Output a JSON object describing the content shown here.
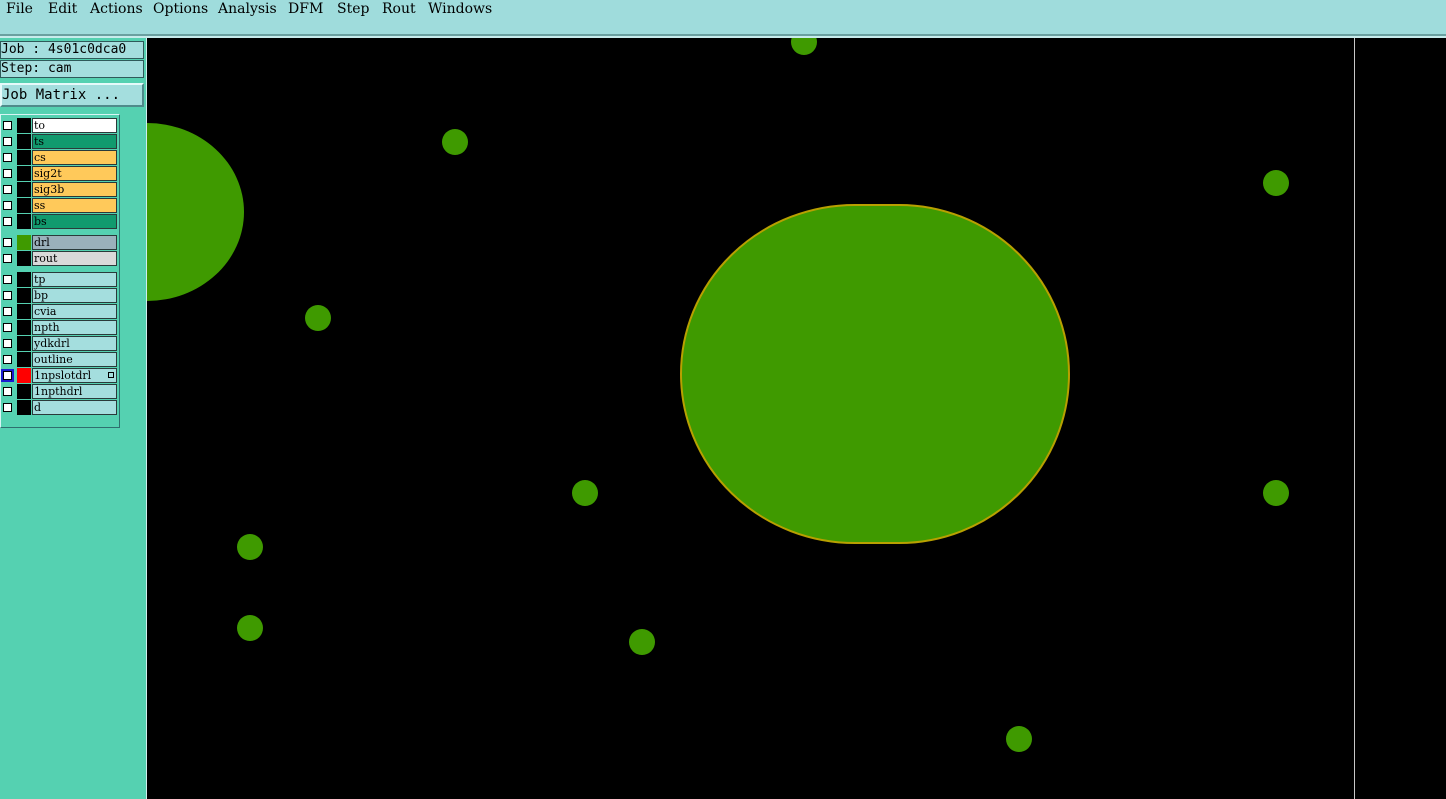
{
  "menu": [
    {
      "label": "File"
    },
    {
      "label": "Edit"
    },
    {
      "label": "Actions"
    },
    {
      "label": "Options"
    },
    {
      "label": "Analysis"
    },
    {
      "label": "DFM"
    },
    {
      "label": "Step"
    },
    {
      "label": "Rout"
    },
    {
      "label": "Windows"
    }
  ],
  "job": {
    "text": "Job : 4s01c0dca0"
  },
  "step": {
    "text": "Step: cam"
  },
  "job_matrix": {
    "label": "Job Matrix ..."
  },
  "layers": [
    {
      "name": "to",
      "color": "#ffffff",
      "swatch": "#000000"
    },
    {
      "name": "ts",
      "color": "#119a6e",
      "swatch": "#000000"
    },
    {
      "name": "cs",
      "color": "#ffc95a",
      "swatch": "#000000"
    },
    {
      "name": "sig2t",
      "color": "#ffc95a",
      "swatch": "#000000"
    },
    {
      "name": "sig3b",
      "color": "#ffc95a",
      "swatch": "#000000"
    },
    {
      "name": "ss",
      "color": "#ffc95a",
      "swatch": "#000000"
    },
    {
      "name": "bs",
      "color": "#119a6e",
      "swatch": "#000000"
    },
    {
      "name": "drl",
      "color": "#9ab1bb",
      "swatch": "#3f9a00"
    },
    {
      "name": "rout",
      "color": "#d9d9d9",
      "swatch": "#000000"
    },
    {
      "name": "tp",
      "color": "#a4dede",
      "swatch": "#000000"
    },
    {
      "name": "bp",
      "color": "#a4dede",
      "swatch": "#000000"
    },
    {
      "name": "cvia",
      "color": "#a4dede",
      "swatch": "#000000"
    },
    {
      "name": "npth",
      "color": "#a4dede",
      "swatch": "#000000"
    },
    {
      "name": "ydkdrl",
      "color": "#a4dede",
      "swatch": "#000000"
    },
    {
      "name": "outline",
      "color": "#a4dede",
      "swatch": "#000000"
    },
    {
      "name": "1npslotdrl",
      "color": "#a4dede",
      "swatch": "#ff0000",
      "active": true
    },
    {
      "name": "1npthdrl",
      "color": "#a4dede",
      "swatch": "#000000"
    },
    {
      "name": "d",
      "color": "#a4dede",
      "swatch": "#000000"
    }
  ],
  "colors": {
    "pad": "#3f9a00",
    "pad_outline": "#b8a000",
    "canvas": "#000000",
    "menubar": "#9fdcdc",
    "panel": "#55d1b1"
  }
}
